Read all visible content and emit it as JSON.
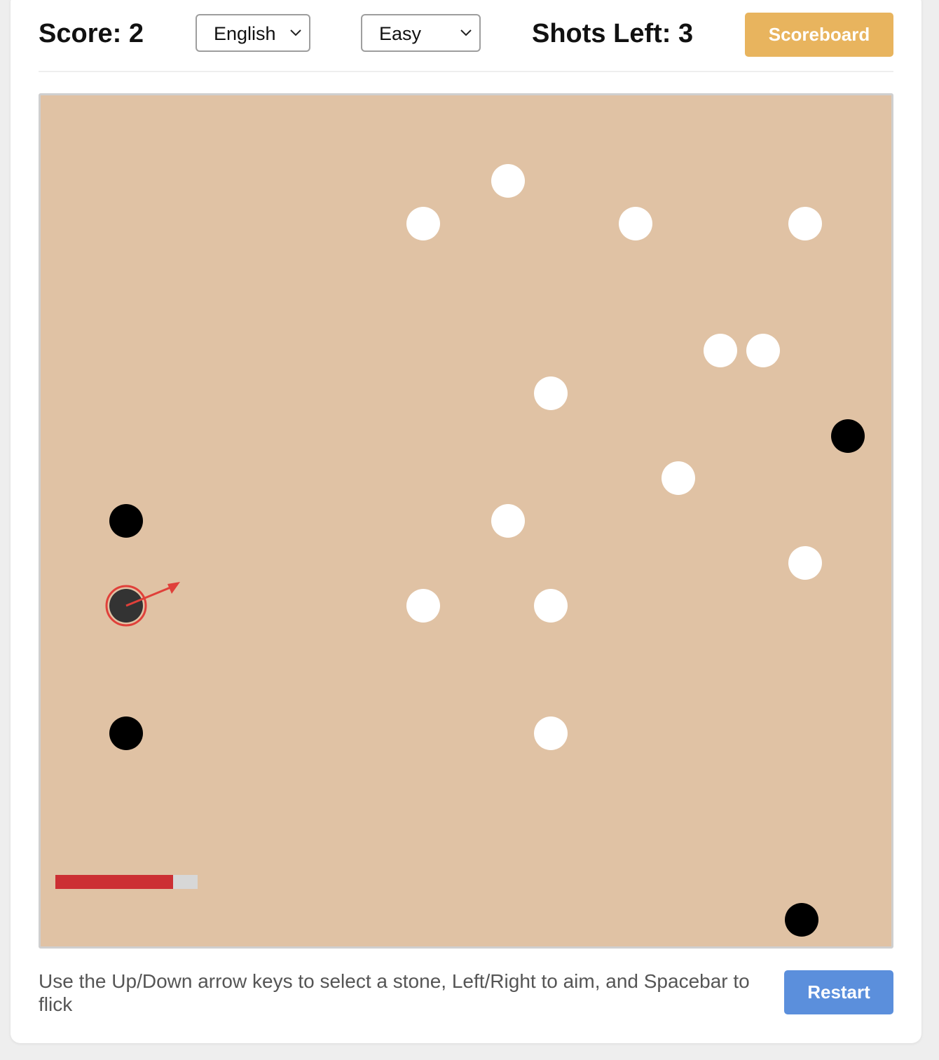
{
  "header": {
    "score_text": "Score: 2",
    "language_selected": "English",
    "difficulty_selected": "Easy",
    "shots_text": "Shots Left: 3",
    "scoreboard_label": "Scoreboard"
  },
  "board": {
    "background_color": "#e0c2a4",
    "white_stone_color": "#ffffff",
    "black_stone_color": "#000000",
    "selected_stone_color": "#333333",
    "selection_ring_color": "#e0403a",
    "aim_arrow_color": "#e0403a",
    "power_bar": {
      "fill_fraction": 0.83,
      "fill_color": "#cc2f33",
      "track_color": "#d7d7d7"
    }
  },
  "footer": {
    "instructions": "Use the Up/Down arrow keys to select a stone, Left/Right to aim, and Spacebar to flick",
    "restart_label": "Restart"
  },
  "colors": {
    "scoreboard_button": "#e8b45e",
    "restart_button": "#5b8fdc"
  }
}
